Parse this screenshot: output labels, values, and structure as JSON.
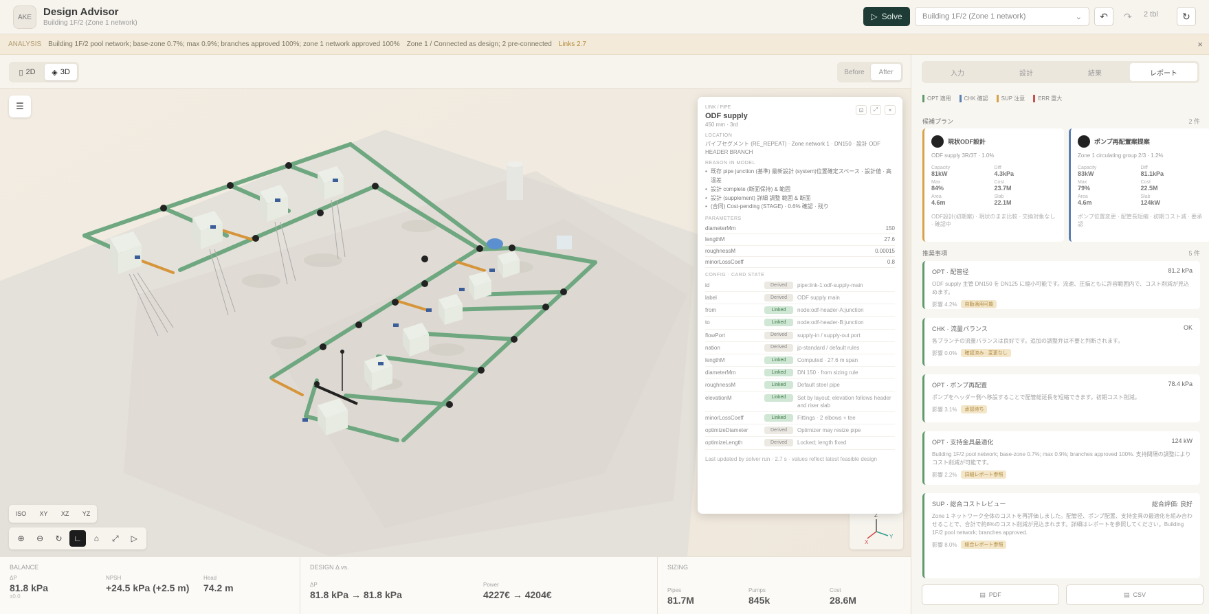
{
  "app": {
    "logo": "AKE",
    "title": "Design Advisor",
    "subtitle": "Building 1F/2 (Zone 1 network)"
  },
  "toolbar": {
    "run_label": "Solve",
    "scenario_value": "Building 1F/2 (Zone 1 network)",
    "undo_icon": "undo-icon",
    "redo_icon": "redo-icon",
    "count_label": "2 tbl",
    "reset_icon": "reset-icon"
  },
  "banner": {
    "tag": "ANALYSIS",
    "text": "Building 1F/2 pool network; base-zone 0.7%; max 0.9%; branches approved 100%; zone 1 network approved 100%",
    "detail": "Zone 1 / Connected as design; 2 pre-connected",
    "link": "Links 2.7",
    "close": "×"
  },
  "viewport": {
    "mode_2d": "2D",
    "mode_3d": "3D",
    "view_before": "Before",
    "view_after": "After",
    "projections": [
      "ISO",
      "XY",
      "XZ",
      "YZ"
    ],
    "axis_x": "X",
    "axis_y": "Y",
    "axis_z": "Z"
  },
  "inspector": {
    "overline": "LINK / PIPE",
    "title": "ODF supply",
    "meta": "450 mm · 3rd",
    "desc_label": "Location",
    "desc": "パイプセグメント (RE_REPEAT) · Zone network 1 · DN150 · 設計 ODF HEADER BRANCH",
    "reasons_label": "Reason in model",
    "reasons": [
      "既存 pipe junction  (基準) 最新設計 (system)位置確定スペース · 設計値 · 高温差",
      "設計 complete (断面保持) & 範囲",
      "設計 (supplement) 詳細 調整 範囲 & 断面",
      "(合同) Cost-pending (STAGE) · 0.6% 確認 · 残り"
    ],
    "params_label": "Parameters",
    "params": [
      {
        "k": "diameterMm",
        "v": "150"
      },
      {
        "k": "lengthM",
        "v": "27.6"
      },
      {
        "k": "roughnessM",
        "v": "0.00015"
      },
      {
        "k": "minorLossCoeff",
        "v": "0.8"
      }
    ],
    "config_label": "CONFIG · Card state",
    "config": [
      {
        "k": "id",
        "chip": "Derived",
        "tone": "gray",
        "v": "pipe:link-1:odf-supply-main"
      },
      {
        "k": "label",
        "chip": "Derived",
        "tone": "gray",
        "v": "ODF supply main"
      },
      {
        "k": "from",
        "chip": "Linked",
        "tone": "green",
        "v": "node:odf-header-A:junction"
      },
      {
        "k": "to",
        "chip": "Linked",
        "tone": "green",
        "v": "node:odf-header-B:junction"
      },
      {
        "k": "flowPort",
        "chip": "Derived",
        "tone": "gray",
        "v": "supply-in / supply-out port"
      },
      {
        "k": "nation",
        "chip": "Derived",
        "tone": "gray",
        "v": "jp-standard / default rules"
      },
      {
        "k": "lengthM",
        "chip": "Linked",
        "tone": "green",
        "v": "Computed · 27.6 m span"
      },
      {
        "k": "diameterMm",
        "chip": "Linked",
        "tone": "green",
        "v": "DN 150 · from sizing rule"
      },
      {
        "k": "roughnessM",
        "chip": "Linked",
        "tone": "green",
        "v": "Default steel pipe"
      },
      {
        "k": "elevationM",
        "chip": "Linked",
        "tone": "green",
        "v": "Set by layout; elevation follows header and riser slab"
      },
      {
        "k": "minorLossCoeff",
        "chip": "Linked",
        "tone": "green",
        "v": "Fittings · 2 elbows + tee"
      },
      {
        "k": "optimizeDiameter",
        "chip": "Derived",
        "tone": "gray",
        "v": "Optimizer may resize pipe"
      },
      {
        "k": "optimizeLength",
        "chip": "Derived",
        "tone": "gray",
        "v": "Locked; length fixed"
      }
    ],
    "footer": "Last updated by solver run · 2.7 s · values reflect latest feasible design",
    "btn_pin": "⊡",
    "btn_expand": "⤢",
    "btn_close": "×"
  },
  "metrics": {
    "sections": [
      {
        "label": "BALANCE",
        "cells": [
          {
            "k": "ΔP",
            "v": "81.8 kPa",
            "s": "±0.0"
          },
          {
            "k": "NPSH",
            "v": "+24.5 kPa (+2.5 m)",
            "s": ""
          },
          {
            "k": "Head",
            "v": "74.2 m",
            "s": ""
          }
        ]
      },
      {
        "label": "DESIGN Δ vs.",
        "cells": [
          {
            "k": "ΔP",
            "v": "81.8 kPa → 81.8 kPa",
            "s": ""
          },
          {
            "k": "Power",
            "v": "4227€ → 4204€",
            "s": ""
          }
        ]
      },
      {
        "label": "SIZING",
        "cells": [
          {
            "k": "Pipes",
            "v": "81.7M",
            "s": ""
          },
          {
            "k": "Pumps",
            "v": "845k",
            "s": ""
          },
          {
            "k": "Cost",
            "v": "28.6M",
            "s": ""
          }
        ]
      }
    ]
  },
  "panel": {
    "tabs": [
      "入力",
      "設計",
      "結果",
      "レポート"
    ],
    "active_tab": 3,
    "legend": [
      {
        "label": "OPT 適用",
        "color": "#5f9a6c"
      },
      {
        "label": "CHK 確認",
        "color": "#5a7fb3"
      },
      {
        "label": "SUP 注意",
        "color": "#d8a04a"
      },
      {
        "label": "ERR 重大",
        "color": "#c75050"
      }
    ],
    "variants_label": "候補プラン",
    "variants_count": "2 件",
    "variants": [
      {
        "title": "現状ODF設計",
        "sub": "ODF supply 3R/3T · 1.0%",
        "color": "#d8a04a",
        "grid": [
          {
            "k": "Capacity",
            "v": "81kW"
          },
          {
            "k": "Diff",
            "v": "4.3kPa"
          },
          {
            "k": "Max",
            "v": "84%"
          },
          {
            "k": "Cost",
            "v": "23.7M"
          },
          {
            "k": "Area",
            "v": "4.6m"
          },
          {
            "k": "Slab",
            "v": "22.1M"
          }
        ],
        "note": "ODF設計(初期案) · 現状のまま比較 · 交換対象なし · 確認中"
      },
      {
        "title": "ポンプ再配置案提案",
        "sub": "Zone 1 circulating group 2/3 · 1.2%",
        "color": "#5a7fb3",
        "grid": [
          {
            "k": "Capacity",
            "v": "83kW"
          },
          {
            "k": "Diff",
            "v": "81.1kPa"
          },
          {
            "k": "Max",
            "v": "79%"
          },
          {
            "k": "Cost",
            "v": "22.5M"
          },
          {
            "k": "Area",
            "v": "4.6m"
          },
          {
            "k": "Slab",
            "v": "124kW"
          }
        ],
        "note": "ポンプ位置変更 · 配管長短縮 · 初期コスト減 · 要承認"
      }
    ],
    "recs_label": "推奨事項",
    "recs_count": "5 件",
    "recs": [
      {
        "title": "OPT · 配管径",
        "right": "81.2 kPa",
        "body": "ODF supply 主管 DN150 を DN125 に縮小可能です。流速、圧損ともに許容範囲内で、コスト削減が見込めます。",
        "foot": "影響 4.2%",
        "badge": "自動適用可能"
      },
      {
        "title": "CHK · 流量バランス",
        "right": "OK",
        "body": "各ブランチの流量バランスは良好です。追加の調整弁は不要と判断されます。",
        "foot": "影響 0.0%",
        "badge": "確認済み · 変更なし"
      },
      {
        "title": "OPT · ポンプ再配置",
        "right": "78.4 kPa",
        "body": "ポンプをヘッダー側へ移設することで配管総延長を短縮できます。初期コスト削減。",
        "foot": "影響 3.1%",
        "badge": "承認待ち"
      },
      {
        "title": "OPT · 支持金具最適化",
        "right": "124 kW",
        "body": "Building 1F/2 pool network; base-zone 0.7%; max 0.9%; branches approved 100%. 支持間隔の調整によりコスト削減が可能です。",
        "foot": "影響 2.2%",
        "badge": "詳細レポート参照"
      },
      {
        "title": "SUP · 総合コストレビュー",
        "right": "総合評価: 良好",
        "body": "Zone 1 ネットワーク全体のコストを再評価しました。配管径、ポンプ配置、支持金具の最適化を組み合わせることで、合計で約8%のコスト削減が見込まれます。詳細はレポートを参照してください。Building 1F/2 pool network; branches approved.",
        "foot": "影響 8.0%",
        "badge": "総合レポート参照"
      }
    ],
    "export_pdf": "PDF",
    "export_csv": "CSV"
  }
}
